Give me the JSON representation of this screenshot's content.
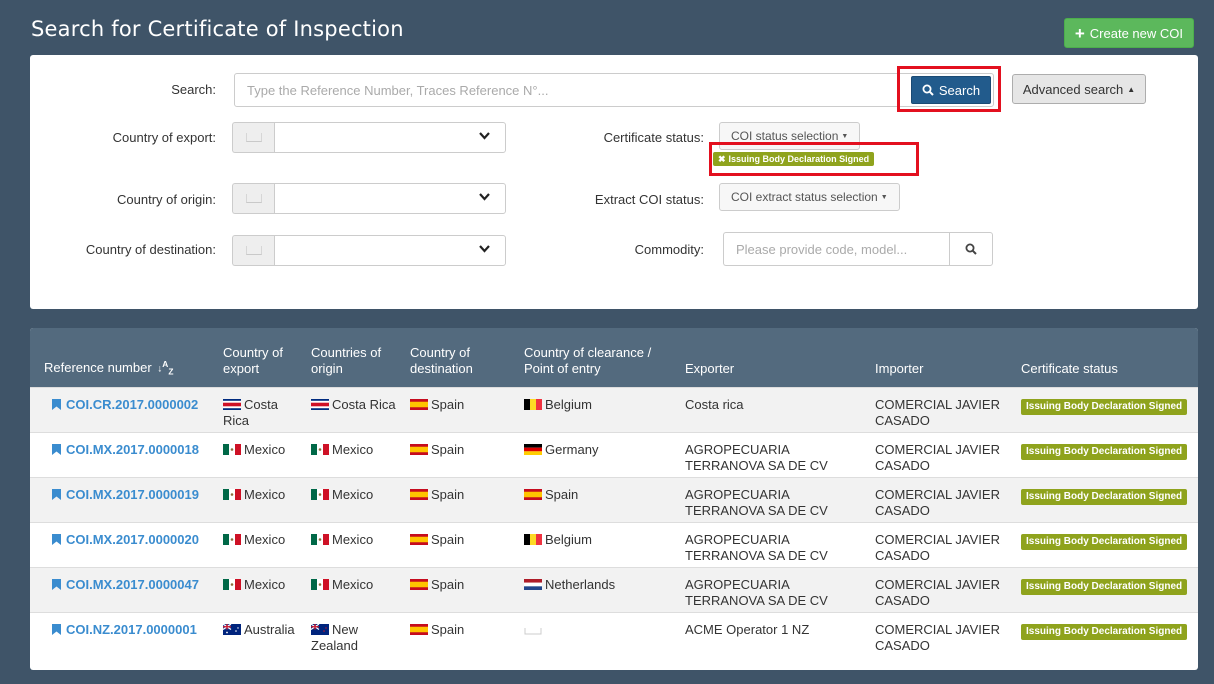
{
  "header": {
    "title": "Search for Certificate of Inspection",
    "create_button": "Create new COI"
  },
  "search": {
    "label": "Search:",
    "placeholder": "Type the Reference Number, Traces Reference N°...",
    "button": "Search",
    "advanced_button": "Advanced search"
  },
  "filters": {
    "country_export_label": "Country of export:",
    "country_origin_label": "Country of origin:",
    "country_destination_label": "Country of destination:",
    "certificate_status_label": "Certificate status:",
    "certificate_status_dropdown": "COI status selection",
    "certificate_status_selected_tag": "Issuing Body Declaration Signed",
    "extract_status_label": "Extract COI status:",
    "extract_status_dropdown": "COI extract status selection",
    "commodity_label": "Commodity:",
    "commodity_placeholder": "Please provide code, model..."
  },
  "table": {
    "headers": [
      "Reference number",
      "Country of export",
      "Countries of origin",
      "Country of destination",
      "Country of clearance / Point of entry",
      "Exporter",
      "Importer",
      "Certificate status"
    ],
    "rows": [
      {
        "ref": "COI.CR.2017.0000002",
        "export": "Costa Rica",
        "export_flag": "costa-rica",
        "origin": "Costa Rica",
        "origin_flag": "costa-rica",
        "destination": "Spain",
        "destination_flag": "spain",
        "clearance": "Belgium",
        "clearance_flag": "belgium",
        "exporter": "Costa rica",
        "importer": "COMERCIAL JAVIER CASADO",
        "status": "Issuing Body Declaration Signed"
      },
      {
        "ref": "COI.MX.2017.0000018",
        "export": "Mexico",
        "export_flag": "mexico",
        "origin": "Mexico",
        "origin_flag": "mexico",
        "destination": "Spain",
        "destination_flag": "spain",
        "clearance": "Germany",
        "clearance_flag": "germany",
        "exporter": "AGROPECUARIA TERRANOVA SA DE CV",
        "importer": "COMERCIAL JAVIER CASADO",
        "status": "Issuing Body Declaration Signed"
      },
      {
        "ref": "COI.MX.2017.0000019",
        "export": "Mexico",
        "export_flag": "mexico",
        "origin": "Mexico",
        "origin_flag": "mexico",
        "destination": "Spain",
        "destination_flag": "spain",
        "clearance": "Spain",
        "clearance_flag": "spain",
        "exporter": "AGROPECUARIA TERRANOVA SA DE CV",
        "importer": "COMERCIAL JAVIER CASADO",
        "status": "Issuing Body Declaration Signed"
      },
      {
        "ref": "COI.MX.2017.0000020",
        "export": "Mexico",
        "export_flag": "mexico",
        "origin": "Mexico",
        "origin_flag": "mexico",
        "destination": "Spain",
        "destination_flag": "spain",
        "clearance": "Belgium",
        "clearance_flag": "belgium",
        "exporter": "AGROPECUARIA TERRANOVA SA DE CV",
        "importer": "COMERCIAL JAVIER CASADO",
        "status": "Issuing Body Declaration Signed"
      },
      {
        "ref": "COI.MX.2017.0000047",
        "export": "Mexico",
        "export_flag": "mexico",
        "origin": "Mexico",
        "origin_flag": "mexico",
        "destination": "Spain",
        "destination_flag": "spain",
        "clearance": "Netherlands",
        "clearance_flag": "netherlands",
        "exporter": "AGROPECUARIA TERRANOVA SA DE CV",
        "importer": "COMERCIAL JAVIER CASADO",
        "status": "Issuing Body Declaration Signed"
      },
      {
        "ref": "COI.NZ.2017.0000001",
        "export": "Australia",
        "export_flag": "australia",
        "origin": "New Zealand",
        "origin_flag": "new-zealand",
        "destination": "Spain",
        "destination_flag": "spain",
        "clearance": "",
        "clearance_flag": "none",
        "exporter": "ACME Operator 1 NZ",
        "importer": "COMERCIAL JAVIER CASADO",
        "status": "Issuing Body Declaration Signed"
      }
    ]
  },
  "colors": {
    "background": "#3f5468",
    "table_header": "#536a7e",
    "status_badge": "#8fa31d",
    "link": "#3a8ccf",
    "primary_button": "#225b8c",
    "success_button": "#5cb85c",
    "highlight_box": "#e3101f"
  }
}
